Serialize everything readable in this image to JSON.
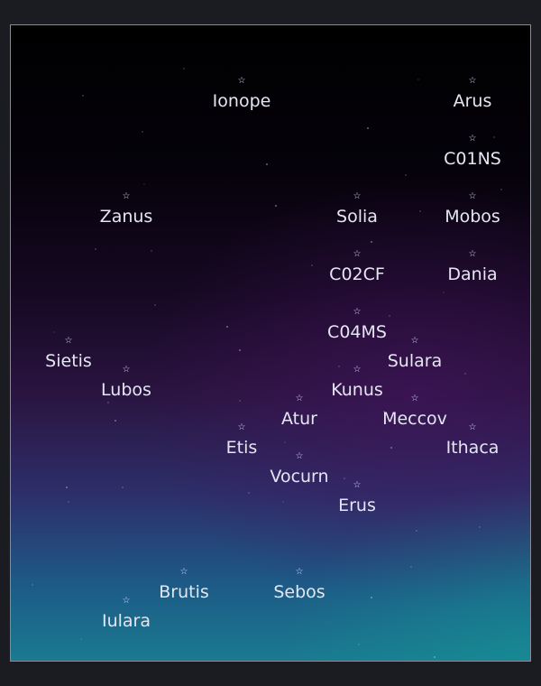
{
  "colors": {
    "page_background": "#1b1b22",
    "label_text": "#e4e6f2",
    "star_marker": "#cfd8ff",
    "frame_border": "#8a8a94"
  },
  "star_icon": "white-star-outline",
  "systems": [
    {
      "name": "Ionope"
    },
    {
      "name": "Arus"
    },
    {
      "name": "C01NS"
    },
    {
      "name": "Zanus"
    },
    {
      "name": "Solia"
    },
    {
      "name": "Mobos"
    },
    {
      "name": "C02CF"
    },
    {
      "name": "Dania"
    },
    {
      "name": "C04MS"
    },
    {
      "name": "Sietis"
    },
    {
      "name": "Sulara"
    },
    {
      "name": "Lubos"
    },
    {
      "name": "Kunus"
    },
    {
      "name": "Atur"
    },
    {
      "name": "Meccov"
    },
    {
      "name": "Etis"
    },
    {
      "name": "Ithaca"
    },
    {
      "name": "Vocurn"
    },
    {
      "name": "Erus"
    },
    {
      "name": "Brutis"
    },
    {
      "name": "Sebos"
    },
    {
      "name": "Iulara"
    }
  ]
}
